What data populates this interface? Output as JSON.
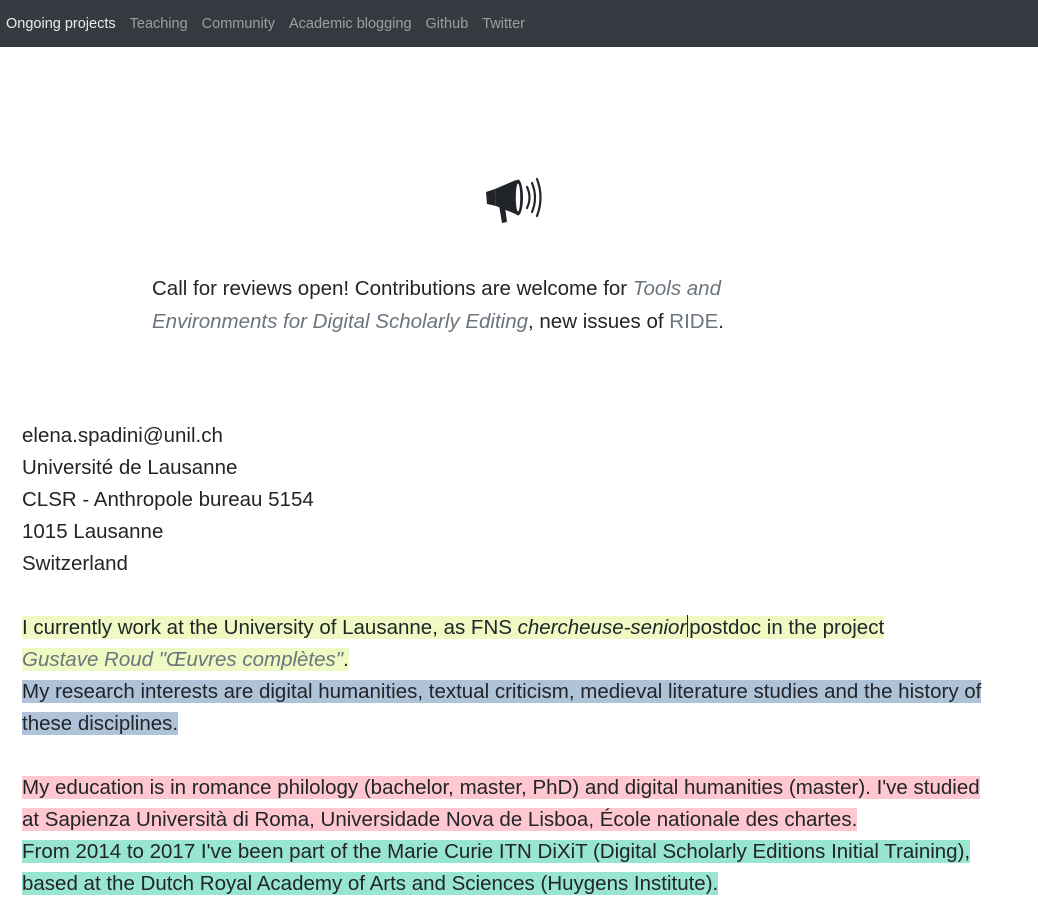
{
  "nav": {
    "items": [
      "Ongoing projects",
      "Teaching",
      "Community",
      "Academic blogging",
      "Github",
      "Twitter"
    ]
  },
  "announcement": {
    "icon": "megaphone-icon",
    "text_before": "Call for reviews open! Contributions are welcome for ",
    "link_title": "Tools and Environments for Digital Scholarly Editing",
    "text_middle": ", new issues of ",
    "link_ride": "RIDE",
    "text_end": "."
  },
  "contact": {
    "email": "elena.spadini@unil.ch",
    "institution": "Université de Lausanne",
    "office": "CLSR - Anthropole bureau 5154",
    "city": "1015 Lausanne",
    "country": "Switzerland"
  },
  "bio": {
    "current_before": "I currently work at the University of Lausanne, as FNS ",
    "current_role": "chercheuse-senior",
    "current_after": "postdoc in the project ",
    "project_link": "Gustave Roud \"Œuvres complètes\"",
    "current_end": ".",
    "research": "My research interests are digital humanities, textual criticism, medieval literature studies and the history of these disciplines.",
    "education": "My education is in romance philology (bachelor, master, PhD) and digital humanities (master). I've studied at Sapienza Università di Roma, Universidade Nova de Lisboa, École nationale des chartes.",
    "dixit": "From 2014 to 2017 I've been part of the Marie Curie ITN DiXiT (Digital Scholarly Editions Initial Training), based at the Dutch Royal Academy of Arts and Sciences (Huygens Institute)."
  },
  "colors": {
    "navbar": "#343a40",
    "highlight_current": "#eff9c3",
    "highlight_research": "#afc3d8",
    "highlight_education": "#ffc8d0",
    "highlight_dixit": "#98e6d0",
    "link_muted": "#6c757d"
  }
}
